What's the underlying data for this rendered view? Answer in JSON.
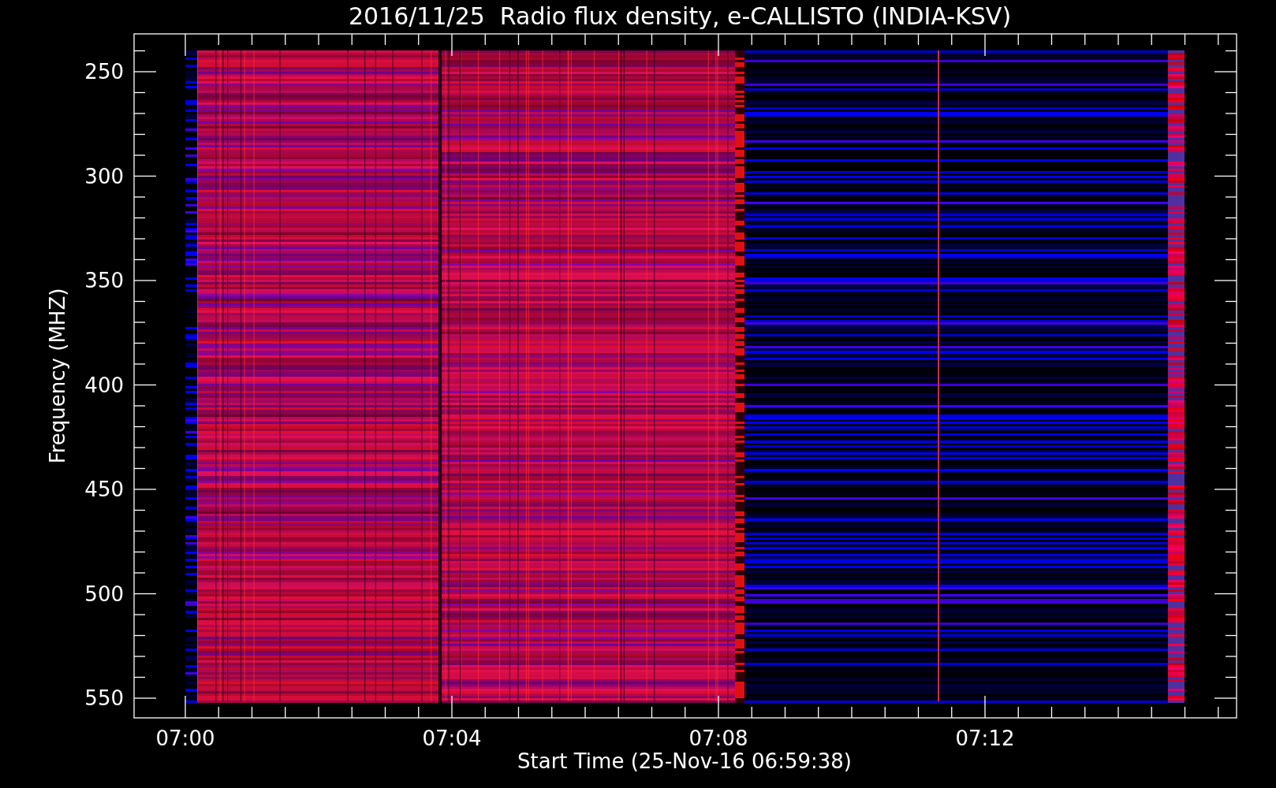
{
  "title": "2016/11/25  Radio flux density, e-CALLISTO (INDIA-KSV)",
  "plot": {
    "y_axis_label": "Frequency (MHZ)",
    "x_axis_label": "Start Time (25-Nov-16 06:59:38)",
    "y_ticks": [
      "250",
      "300",
      "350",
      "400",
      "450",
      "500",
      "550"
    ],
    "x_ticks": [
      "07:00",
      "07:04",
      "07:08",
      "07:12"
    ]
  }
}
